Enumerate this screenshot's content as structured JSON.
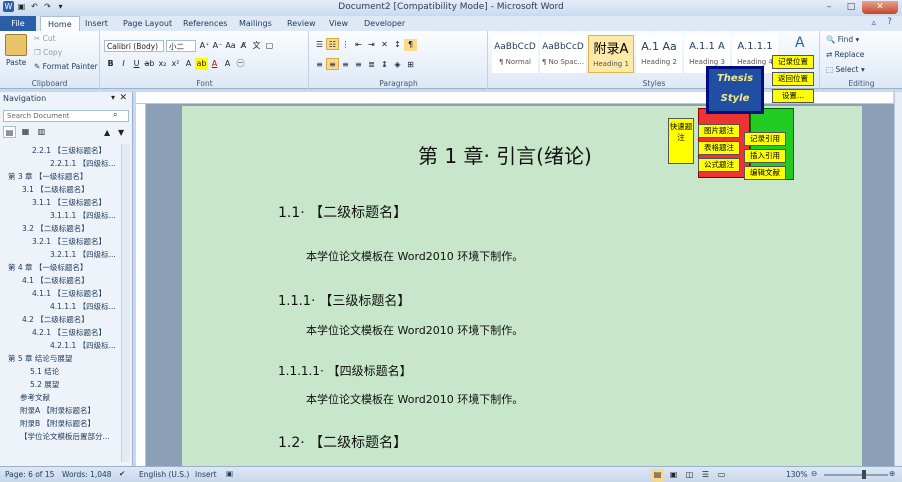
{
  "window": {
    "title": "Document2 [Compatibility Mode] - Microsoft Word"
  },
  "ribbon_tabs": [
    "File",
    "Home",
    "Insert",
    "Page Layout",
    "References",
    "Mailings",
    "Review",
    "View",
    "Developer"
  ],
  "clipboard": {
    "paste": "Paste",
    "cut": "Cut",
    "copy": "Copy",
    "format_painter": "Format Painter",
    "group": "Clipboard"
  },
  "font": {
    "family": "Calibri (Body)",
    "size": "小二",
    "group": "Font"
  },
  "paragraph": {
    "group": "Paragraph"
  },
  "styles": {
    "group": "Styles",
    "items": [
      {
        "preview": "AaBbCcD",
        "name": "¶ Normal"
      },
      {
        "preview": "AaBbCcD",
        "name": "¶ No Spac..."
      },
      {
        "preview": "附录A",
        "name": "Heading 1"
      },
      {
        "preview": "A.1 Aa",
        "name": "Heading 2"
      },
      {
        "preview": "A.1.1 A",
        "name": "Heading 3"
      },
      {
        "preview": "A.1.1.1",
        "name": "Heading 4"
      }
    ],
    "change": "Change Styles"
  },
  "editing": {
    "find": "Find",
    "replace": "Replace",
    "select": "Select",
    "group": "Editing"
  },
  "navigation": {
    "title": "Navigation",
    "search_placeholder": "Search Document",
    "items": [
      "2.2.1 【三级标题名】",
      "2.2.1.1 【四级标...",
      "第 3 章 【一级标题名】",
      "3.1 【二级标题名】",
      "3.1.1 【三级标题名】",
      "3.1.1.1 【四级标...",
      "3.2 【二级标题名】",
      "3.2.1 【三级标题名】",
      "3.2.1.1 【四级标...",
      "第 4 章 【一级标题名】",
      "4.1 【二级标题名】",
      "4.1.1 【三级标题名】",
      "4.1.1.1 【四级标...",
      "4.2 【二级标题名】",
      "4.2.1 【三级标题名】",
      "4.2.1.1 【四级标...",
      "第 5 章 结论与展望",
      "5.1 结论",
      "5.2 展望",
      "参考文献",
      "附录A 【附录标题名】",
      "附录B 【附录标题名】",
      "【学位论文模板后置部分..."
    ]
  },
  "document": {
    "chapter": "第 1 章· 引言(绪论)",
    "h2a": "1.1· 【二级标题名】",
    "p1": "本学位论文模板在 Word2010 环境下制作。",
    "h3": "1.1.1· 【三级标题名】",
    "p2": "本学位论文模板在 Word2010 环境下制作。",
    "h4": "1.1.1.1· 【四级标题名】",
    "p3": "本学位论文模板在 Word2010 环境下制作。",
    "h2b": "1.2· 【二级标题名】"
  },
  "toolbox": {
    "logo": "Thesis Style",
    "record_pos": "记录位置",
    "return_pos": "返回位置",
    "settings": "设置...",
    "quick_label": "快速题注",
    "fig_caption": "图片题注",
    "table_caption": "表格题注",
    "formula_caption": "公式题注",
    "record_ref": "记录引用",
    "insert_ref": "插入引用",
    "edit_ref": "编辑文献"
  },
  "status": {
    "page": "Page: 6 of 15",
    "words": "Words: 1,048",
    "language": "English (U.S.)",
    "mode": "Insert",
    "zoom": "130%"
  }
}
